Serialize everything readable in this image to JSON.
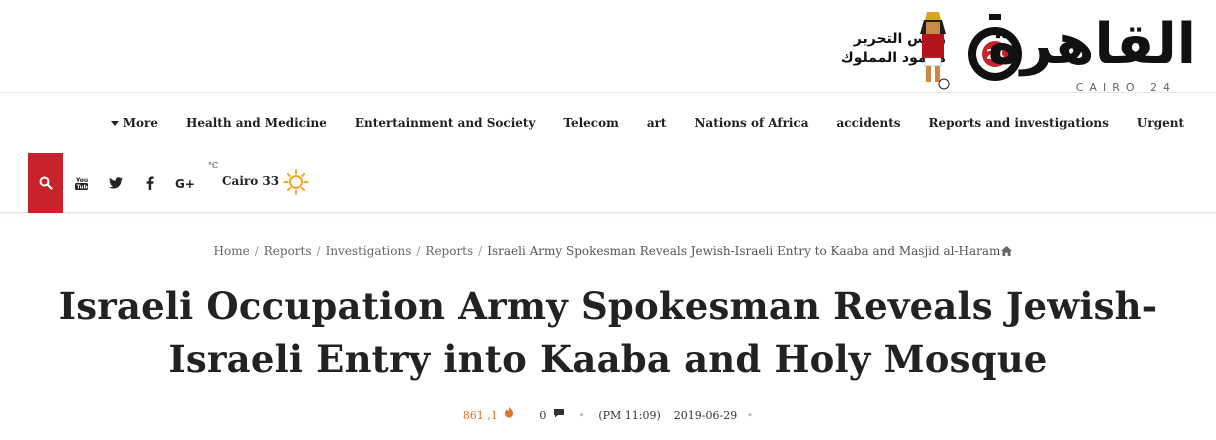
{
  "logo": {
    "arabic": "القاهرة",
    "latin": "CAIRO 24",
    "badge": "24",
    "editor_line1": "رئيس التحرير",
    "editor_line2": "محمود المملوك"
  },
  "nav": {
    "more_label": "More",
    "items": [
      {
        "label": "Health and Medicine"
      },
      {
        "label": "Entertainment and Society"
      },
      {
        "label": "Telecom"
      },
      {
        "label": "art"
      },
      {
        "label": "Nations of Africa"
      },
      {
        "label": "accidents"
      },
      {
        "label": "Reports and investigations"
      },
      {
        "label": "Urgent"
      }
    ]
  },
  "toolbar": {
    "search_icon": "search-icon",
    "social": [
      "youtube-icon",
      "twitter-icon",
      "facebook-icon",
      "google-plus-icon"
    ],
    "weather": {
      "unit": "°C",
      "city_temp": "Cairo 33",
      "icon": "sun-icon"
    },
    "accent_color": "#c8232c"
  },
  "breadcrumb": {
    "items": [
      "Home",
      "Reports",
      "Investigations",
      "Reports"
    ],
    "current": "Israeli Army Spokesman Reveals Jewish-Israeli Entry to Kaaba and Masjid al-Haram"
  },
  "article": {
    "title": "Israeli Occupation Army Spokesman Reveals Jewish-Israeli Entry into Kaaba and Holy Mosque",
    "views": "861 ,1",
    "comments": "0",
    "time": "(PM 11:09)",
    "date": "2019-06-29"
  }
}
